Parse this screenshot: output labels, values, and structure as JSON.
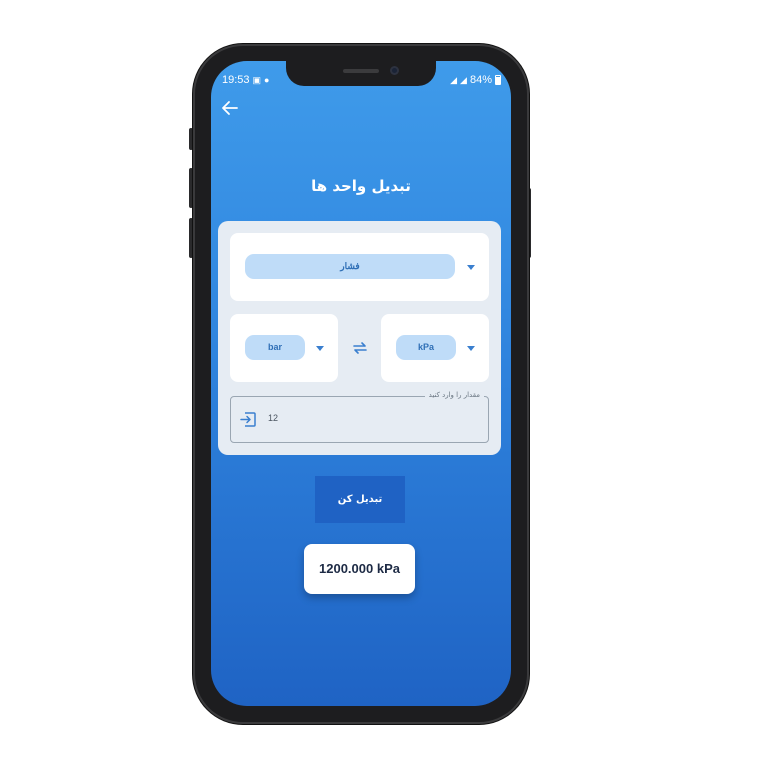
{
  "status_bar": {
    "time": "19:53",
    "battery": "84%",
    "left_icons": [
      "gallery-icon",
      "cloud-icon",
      "location-icon"
    ],
    "right_icons": [
      "signal-icon",
      "signal-icon",
      "battery-icon"
    ]
  },
  "header": {
    "back_icon": "arrow-left-icon",
    "title": "تبدیل واحد ها"
  },
  "converter": {
    "category": "فشار",
    "to_unit": "bar",
    "from_unit": "kPa",
    "swap_icon": "swap-arrows-icon",
    "input": {
      "label": "مقدار را وارد کنید",
      "value": "12",
      "icon": "input-icon"
    }
  },
  "actions": {
    "convert_label": "تبدیل کن"
  },
  "result": {
    "text": "1200.000 kPa"
  },
  "colors": {
    "screen_top": "#3f9bea",
    "screen_bottom": "#1f63c4",
    "pill_bg": "#bfdcf8",
    "accent": "#3a7fcf",
    "button_bg": "#1f62c4"
  }
}
